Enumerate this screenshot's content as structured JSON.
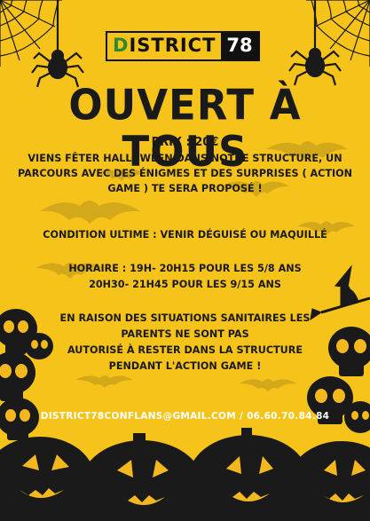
{
  "logo": {
    "text_main": "ISTRICT",
    "text_initial": "D",
    "text_number": "78"
  },
  "headline": "OUVERT À TOUS",
  "price": "PRIX : 20€",
  "intro": [
    "VIENS FÊTER HALLOWEEN DANS NOTRE STRUCTURE, UN",
    "PARCOURS AVEC DES ÉNIGMES ET DES SURPRISES ( ACTION",
    "GAME ) TE SERA PROPOSÉ !"
  ],
  "condition": "CONDITION ULTIME : VENIR DÉGUISÉ OU MAQUILLÉ",
  "hours": [
    "HORAIRE : 19H- 20H15 POUR LES 5/8 ANS",
    "20H30- 21H45 POUR LES 9/15 ANS"
  ],
  "sanitary": [
    "EN RAISON DES SITUATIONS SANITAIRES LES",
    "PARENTS NE SONT PAS",
    "AUTORISÉ À RESTER DANS LA STRUCTURE",
    "PENDANT L'ACTION GAME !"
  ],
  "contact": "DISTRICT78CONFLANS@GMAIL.COM / 06.60.70.84.84",
  "colors": {
    "background": "#f6c31a",
    "ink": "#1a1a1a",
    "logo_green": "#2f8a2f"
  }
}
